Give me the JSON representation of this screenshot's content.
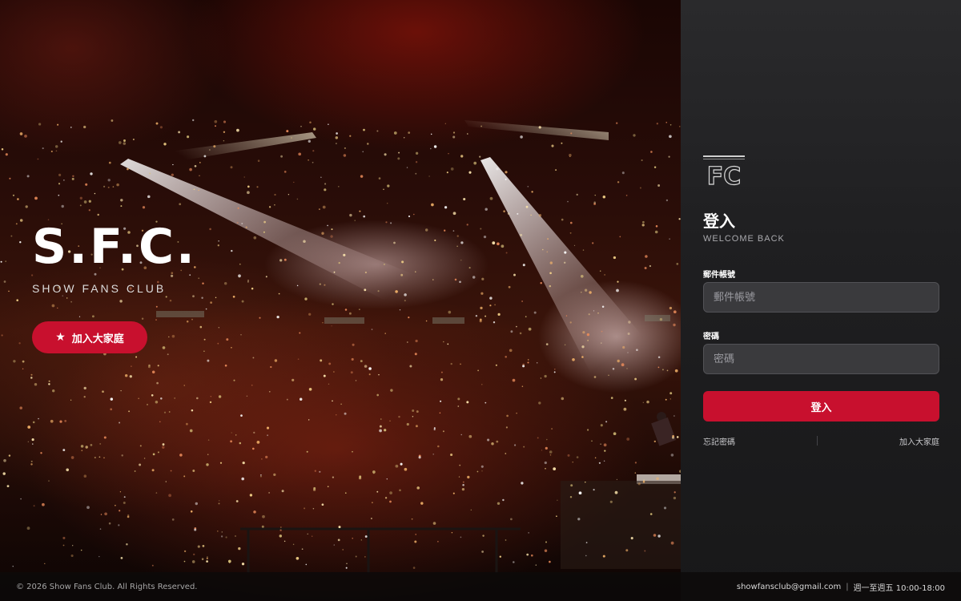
{
  "hero": {
    "brand_title": "S.F.C.",
    "brand_subtitle": "SHOW FANS CLUB",
    "join_button": {
      "icon": "star-icon",
      "label": "加入大家庭"
    }
  },
  "login": {
    "logo_text": "FC",
    "title": "登入",
    "subtitle": "WELCOME BACK",
    "email": {
      "label": "郵件帳號",
      "placeholder": "郵件帳號",
      "value": ""
    },
    "password": {
      "label": "密碼",
      "placeholder": "密碼",
      "value": ""
    },
    "submit_label": "登入",
    "forgot_link": "忘記密碼",
    "join_link": "加入大家庭"
  },
  "footer": {
    "copyright": "© 2026 Show Fans Club. All Rights Reserved.",
    "email": "showfansclub@gmail.com",
    "separator": "|",
    "hours": "週一至週五 10:00-18:00"
  },
  "colors": {
    "accent": "#c8102e",
    "panel_bg": "#1f1f21",
    "field_bg": "#3a3a3d"
  }
}
